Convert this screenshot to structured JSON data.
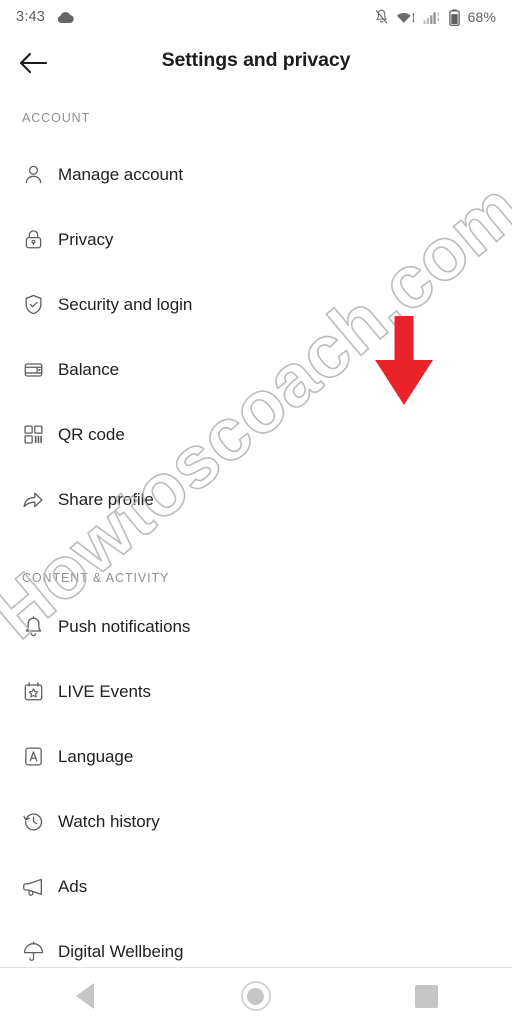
{
  "status_bar": {
    "time": "3:43",
    "weather_icon": "cloud-icon",
    "notifications_silenced_icon": "bell-slash-icon",
    "wifi_icon": "wifi-icon",
    "cellular_icon": "cellular-signal-icon",
    "battery_icon": "battery-icon",
    "battery_percent": "68%"
  },
  "app_bar": {
    "back_icon": "back-arrow-icon",
    "title": "Settings and privacy"
  },
  "sections": [
    {
      "header": "ACCOUNT",
      "items": [
        {
          "label": "Manage account",
          "icon": "person-icon"
        },
        {
          "label": "Privacy",
          "icon": "lock-icon"
        },
        {
          "label": "Security and login",
          "icon": "shield-check-icon"
        },
        {
          "label": "Balance",
          "icon": "wallet-icon"
        },
        {
          "label": "QR code",
          "icon": "qr-code-icon"
        },
        {
          "label": "Share profile",
          "icon": "share-arrow-icon"
        }
      ]
    },
    {
      "header": "CONTENT & ACTIVITY",
      "items": [
        {
          "label": "Push notifications",
          "icon": "bell-icon"
        },
        {
          "label": "LIVE Events",
          "icon": "calendar-star-icon"
        },
        {
          "label": "Language",
          "icon": "letter-a-box-icon"
        },
        {
          "label": "Watch history",
          "icon": "clock-rewind-icon"
        },
        {
          "label": "Ads",
          "icon": "megaphone-icon"
        },
        {
          "label": "Digital Wellbeing",
          "icon": "umbrella-icon"
        }
      ]
    }
  ],
  "annotation": {
    "arrow_icon": "red-down-arrow-icon",
    "arrow_color": "#E8232A",
    "arrow_direction": "down"
  },
  "watermark": {
    "text": "Howtoscoach.com",
    "color": "#b9b9b9"
  },
  "nav_bar": {
    "back_icon": "nav-back-triangle-icon",
    "home_icon": "nav-home-circle-icon",
    "recents_icon": "nav-recents-square-icon"
  },
  "colors": {
    "background": "#ffffff",
    "primary_text": "#212121",
    "secondary_text": "#909090",
    "icon_stroke": "#5d5d5d",
    "accent_red": "#E8232A"
  }
}
